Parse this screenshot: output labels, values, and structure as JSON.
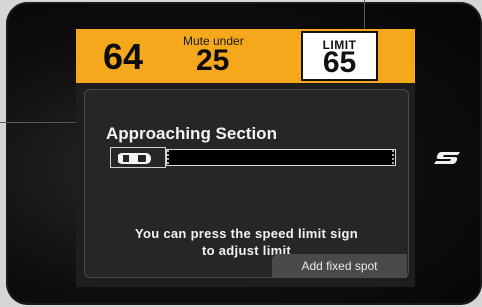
{
  "topbar": {
    "current_speed": "64",
    "mute_label": "Mute under",
    "mute_value": "25",
    "limit_label": "LIMIT",
    "limit_value": "65"
  },
  "panel": {
    "title": "Approaching Section",
    "hint_line1": "You can press the speed limit sign",
    "hint_line2": "to adjust limit"
  },
  "actions": {
    "add_fixed_spot": "Add fixed spot"
  },
  "icons": {
    "vehicle": "car-icon",
    "brand": "brand-logo-icon"
  },
  "colors": {
    "topbar": "#f5a81c",
    "panel": "#262626",
    "sign": "#ffffff"
  }
}
